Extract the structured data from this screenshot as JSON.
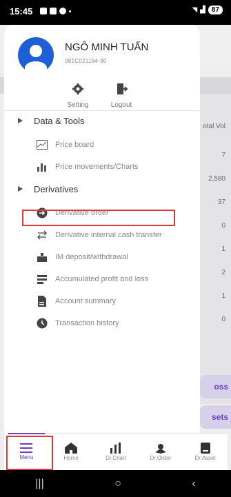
{
  "status_bar": {
    "time": "15:45",
    "battery": "87"
  },
  "user": {
    "name": "NGÔ MINH TUẤN",
    "account_id": "081C021184-80"
  },
  "quick_actions": [
    {
      "label": "Setting",
      "icon": "gear-icon"
    },
    {
      "label": "Logout",
      "icon": "logout-icon"
    }
  ],
  "sections": {
    "data_tools": "Data & Tools",
    "derivatives": "Derivatives"
  },
  "data_tools_items": [
    {
      "label": "Price board",
      "icon": "price-board-icon"
    },
    {
      "label": "Price movements/Charts",
      "icon": "bar-chart-icon"
    }
  ],
  "derivatives_items": [
    {
      "label": "Derivative order",
      "icon": "arrow-circle-icon"
    },
    {
      "label": "Derivative internal cash transfer",
      "icon": "transfer-arrows-icon"
    },
    {
      "label": "IM deposit/withdrawal",
      "icon": "deposit-icon"
    },
    {
      "label": "Accumulated profit and loss",
      "icon": "profit-loss-icon"
    },
    {
      "label": "Account summary",
      "icon": "summary-icon"
    },
    {
      "label": "Transaction history",
      "icon": "clock-icon"
    }
  ],
  "background": {
    "column_header": "otal Vol",
    "values": [
      "7",
      "2,580",
      "37",
      "0",
      "1",
      "2",
      "1",
      "0"
    ],
    "button_1": "oss",
    "button_2": "sets"
  },
  "bottom_nav": [
    {
      "label": "Menu",
      "icon": "menu-icon"
    },
    {
      "label": "Home",
      "icon": "home-icon"
    },
    {
      "label": "Dr.Chart",
      "icon": "chart-icon"
    },
    {
      "label": "Dr.Order",
      "icon": "order-icon"
    },
    {
      "label": "Dr.Asset",
      "icon": "asset-icon"
    }
  ],
  "colors": {
    "accent": "#6a3fc1",
    "highlight": "#e23a3a",
    "avatar": "#1e5fd8"
  }
}
